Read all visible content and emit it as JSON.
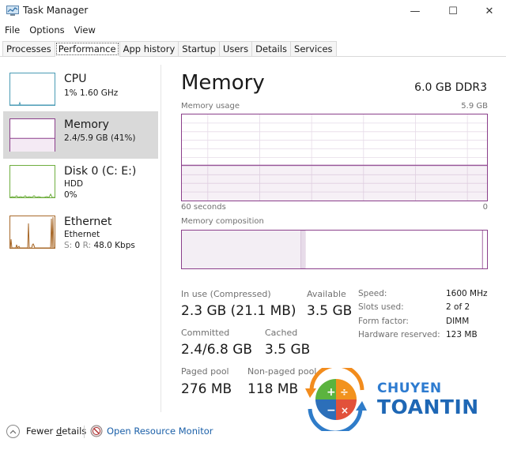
{
  "window": {
    "title": "Task Manager",
    "controls": {
      "minimize": "—",
      "maximize": "☐",
      "close": "✕"
    }
  },
  "menu": [
    "File",
    "Options",
    "View"
  ],
  "tabs": [
    {
      "label": "Processes",
      "active": false
    },
    {
      "label": "Performance",
      "active": true
    },
    {
      "label": "App history",
      "active": false
    },
    {
      "label": "Startup",
      "active": false
    },
    {
      "label": "Users",
      "active": false
    },
    {
      "label": "Details",
      "active": false
    },
    {
      "label": "Services",
      "active": false
    }
  ],
  "sidebar": {
    "items": [
      {
        "title": "CPU",
        "subtitle": "1% 1.60 GHz",
        "color": "#4a9bb5",
        "selected": false
      },
      {
        "title": "Memory",
        "subtitle": "2.4/5.9 GB (41%)",
        "color": "#8b3f8b",
        "selected": true,
        "usage_fraction": 0.41
      },
      {
        "title": "Disk 0 (C: E:)",
        "subtitle": "HDD",
        "subtitle2": "0%",
        "color": "#6fae3f",
        "selected": false
      },
      {
        "title": "Ethernet",
        "subtitle": "Ethernet",
        "subtitle2_s_label": "S:",
        "subtitle2_s_value": "0",
        "subtitle2_r_label": "R:",
        "subtitle2_r_value": "48.0 Kbps",
        "color": "#a8692a",
        "selected": false
      }
    ]
  },
  "main": {
    "title": "Memory",
    "spec": "6.0 GB DDR3",
    "usage_label": "Memory usage",
    "usage_max": "5.9 GB",
    "usage_fraction": 0.41,
    "time_left": "60 seconds",
    "time_right": "0",
    "composition_label": "Memory composition",
    "composition": {
      "in_use_fraction": 0.39,
      "modified_fraction": 0.015,
      "standby_fraction": 0.58,
      "free_fraction": 0.01
    },
    "stats": {
      "in_use_label": "In use (Compressed)",
      "in_use_value": "2.3 GB (21.1 MB)",
      "available_label": "Available",
      "available_value": "3.5 GB",
      "committed_label": "Committed",
      "committed_value": "2.4/6.8 GB",
      "cached_label": "Cached",
      "cached_value": "3.5 GB",
      "paged_label": "Paged pool",
      "paged_value": "276 MB",
      "nonpaged_label": "Non-paged pool",
      "nonpaged_value": "118 MB"
    },
    "details": [
      {
        "label": "Speed:",
        "value": "1600 MHz"
      },
      {
        "label": "Slots used:",
        "value": "2 of 2"
      },
      {
        "label": "Form factor:",
        "value": "DIMM"
      },
      {
        "label": "Hardware reserved:",
        "value": "123 MB"
      }
    ]
  },
  "footer": {
    "fewer_details_prefix": "Fewer ",
    "fewer_details_underlined": "d",
    "fewer_details_suffix": "etails",
    "resource_monitor": "Open Resource Monitor"
  },
  "watermark": {
    "line1": "CHUYEN",
    "line2": "TOANTIN"
  },
  "colors": {
    "memory": "#8b3f8b",
    "memory_fill": "#f4eaf4",
    "link": "#1a5fa8"
  }
}
